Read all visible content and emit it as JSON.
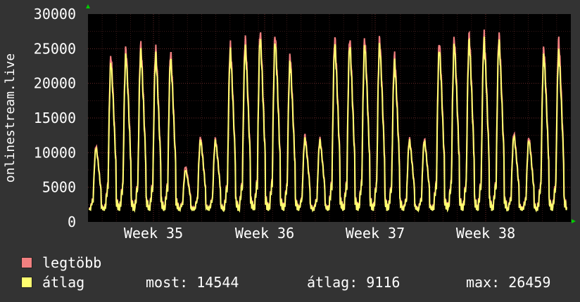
{
  "chart_data": {
    "type": "line",
    "ylabel": "onlinestream.live",
    "ylim": [
      0,
      30000
    ],
    "y_ticks": [
      0,
      5000,
      10000,
      15000,
      20000,
      25000,
      30000
    ],
    "x_ticks": [
      "Week 35",
      "Week 36",
      "Week 37",
      "Week 38"
    ],
    "grid": true,
    "legend_position": "bottom-left",
    "series": [
      {
        "name": "legtöbb",
        "color": "#f28080",
        "daily_peaks": [
          11000,
          24000,
          25000,
          25500,
          25000,
          24500,
          8000,
          12200,
          12000,
          25500,
          26500,
          27500,
          27000,
          24000,
          12500,
          12000,
          26500,
          26500,
          26500,
          26500,
          24000,
          12000,
          12000,
          26000,
          26500,
          27000,
          27000,
          27000,
          12800,
          12200,
          25000,
          26200
        ],
        "daily_lows": 1800
      },
      {
        "name": "átlag",
        "color": "#ffff70",
        "daily_peaks": [
          10700,
          23000,
          24000,
          24500,
          24000,
          23500,
          7500,
          11800,
          11700,
          24500,
          25200,
          26500,
          26000,
          23000,
          12000,
          11700,
          25500,
          25500,
          25500,
          25500,
          23000,
          11700,
          11700,
          25000,
          25500,
          26000,
          26000,
          26000,
          12400,
          11800,
          24000,
          24500
        ],
        "daily_lows": 1700
      }
    ]
  },
  "legend": {
    "items": [
      {
        "label": "legtöbb",
        "color": "#f28080"
      },
      {
        "label": "átlag",
        "color": "#ffff70"
      }
    ],
    "stats": {
      "most": "most: 14544",
      "atlag": "átlag: 9116",
      "max": "max: 26459"
    }
  }
}
